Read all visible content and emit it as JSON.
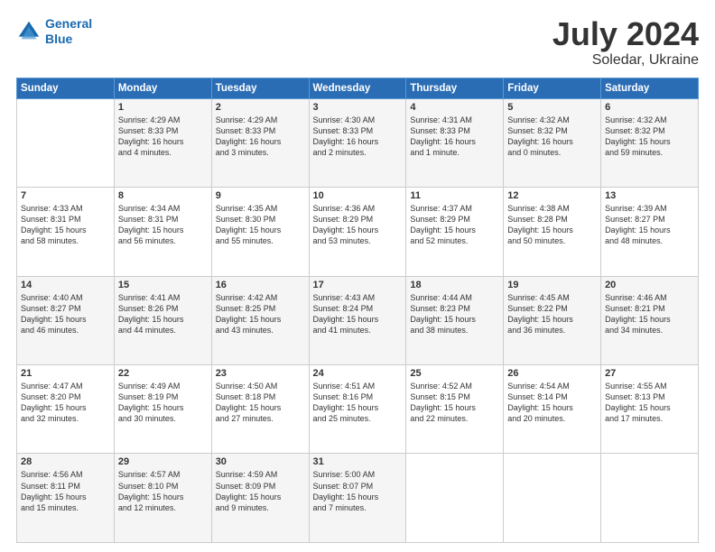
{
  "header": {
    "logo_line1": "General",
    "logo_line2": "Blue",
    "main_title": "July 2024",
    "subtitle": "Soledar, Ukraine"
  },
  "columns": [
    "Sunday",
    "Monday",
    "Tuesday",
    "Wednesday",
    "Thursday",
    "Friday",
    "Saturday"
  ],
  "weeks": [
    [
      {
        "day": "",
        "info": ""
      },
      {
        "day": "1",
        "info": "Sunrise: 4:29 AM\nSunset: 8:33 PM\nDaylight: 16 hours\nand 4 minutes."
      },
      {
        "day": "2",
        "info": "Sunrise: 4:29 AM\nSunset: 8:33 PM\nDaylight: 16 hours\nand 3 minutes."
      },
      {
        "day": "3",
        "info": "Sunrise: 4:30 AM\nSunset: 8:33 PM\nDaylight: 16 hours\nand 2 minutes."
      },
      {
        "day": "4",
        "info": "Sunrise: 4:31 AM\nSunset: 8:33 PM\nDaylight: 16 hours\nand 1 minute."
      },
      {
        "day": "5",
        "info": "Sunrise: 4:32 AM\nSunset: 8:32 PM\nDaylight: 16 hours\nand 0 minutes."
      },
      {
        "day": "6",
        "info": "Sunrise: 4:32 AM\nSunset: 8:32 PM\nDaylight: 15 hours\nand 59 minutes."
      }
    ],
    [
      {
        "day": "7",
        "info": "Sunrise: 4:33 AM\nSunset: 8:31 PM\nDaylight: 15 hours\nand 58 minutes."
      },
      {
        "day": "8",
        "info": "Sunrise: 4:34 AM\nSunset: 8:31 PM\nDaylight: 15 hours\nand 56 minutes."
      },
      {
        "day": "9",
        "info": "Sunrise: 4:35 AM\nSunset: 8:30 PM\nDaylight: 15 hours\nand 55 minutes."
      },
      {
        "day": "10",
        "info": "Sunrise: 4:36 AM\nSunset: 8:29 PM\nDaylight: 15 hours\nand 53 minutes."
      },
      {
        "day": "11",
        "info": "Sunrise: 4:37 AM\nSunset: 8:29 PM\nDaylight: 15 hours\nand 52 minutes."
      },
      {
        "day": "12",
        "info": "Sunrise: 4:38 AM\nSunset: 8:28 PM\nDaylight: 15 hours\nand 50 minutes."
      },
      {
        "day": "13",
        "info": "Sunrise: 4:39 AM\nSunset: 8:27 PM\nDaylight: 15 hours\nand 48 minutes."
      }
    ],
    [
      {
        "day": "14",
        "info": "Sunrise: 4:40 AM\nSunset: 8:27 PM\nDaylight: 15 hours\nand 46 minutes."
      },
      {
        "day": "15",
        "info": "Sunrise: 4:41 AM\nSunset: 8:26 PM\nDaylight: 15 hours\nand 44 minutes."
      },
      {
        "day": "16",
        "info": "Sunrise: 4:42 AM\nSunset: 8:25 PM\nDaylight: 15 hours\nand 43 minutes."
      },
      {
        "day": "17",
        "info": "Sunrise: 4:43 AM\nSunset: 8:24 PM\nDaylight: 15 hours\nand 41 minutes."
      },
      {
        "day": "18",
        "info": "Sunrise: 4:44 AM\nSunset: 8:23 PM\nDaylight: 15 hours\nand 38 minutes."
      },
      {
        "day": "19",
        "info": "Sunrise: 4:45 AM\nSunset: 8:22 PM\nDaylight: 15 hours\nand 36 minutes."
      },
      {
        "day": "20",
        "info": "Sunrise: 4:46 AM\nSunset: 8:21 PM\nDaylight: 15 hours\nand 34 minutes."
      }
    ],
    [
      {
        "day": "21",
        "info": "Sunrise: 4:47 AM\nSunset: 8:20 PM\nDaylight: 15 hours\nand 32 minutes."
      },
      {
        "day": "22",
        "info": "Sunrise: 4:49 AM\nSunset: 8:19 PM\nDaylight: 15 hours\nand 30 minutes."
      },
      {
        "day": "23",
        "info": "Sunrise: 4:50 AM\nSunset: 8:18 PM\nDaylight: 15 hours\nand 27 minutes."
      },
      {
        "day": "24",
        "info": "Sunrise: 4:51 AM\nSunset: 8:16 PM\nDaylight: 15 hours\nand 25 minutes."
      },
      {
        "day": "25",
        "info": "Sunrise: 4:52 AM\nSunset: 8:15 PM\nDaylight: 15 hours\nand 22 minutes."
      },
      {
        "day": "26",
        "info": "Sunrise: 4:54 AM\nSunset: 8:14 PM\nDaylight: 15 hours\nand 20 minutes."
      },
      {
        "day": "27",
        "info": "Sunrise: 4:55 AM\nSunset: 8:13 PM\nDaylight: 15 hours\nand 17 minutes."
      }
    ],
    [
      {
        "day": "28",
        "info": "Sunrise: 4:56 AM\nSunset: 8:11 PM\nDaylight: 15 hours\nand 15 minutes."
      },
      {
        "day": "29",
        "info": "Sunrise: 4:57 AM\nSunset: 8:10 PM\nDaylight: 15 hours\nand 12 minutes."
      },
      {
        "day": "30",
        "info": "Sunrise: 4:59 AM\nSunset: 8:09 PM\nDaylight: 15 hours\nand 9 minutes."
      },
      {
        "day": "31",
        "info": "Sunrise: 5:00 AM\nSunset: 8:07 PM\nDaylight: 15 hours\nand 7 minutes."
      },
      {
        "day": "",
        "info": ""
      },
      {
        "day": "",
        "info": ""
      },
      {
        "day": "",
        "info": ""
      }
    ]
  ]
}
